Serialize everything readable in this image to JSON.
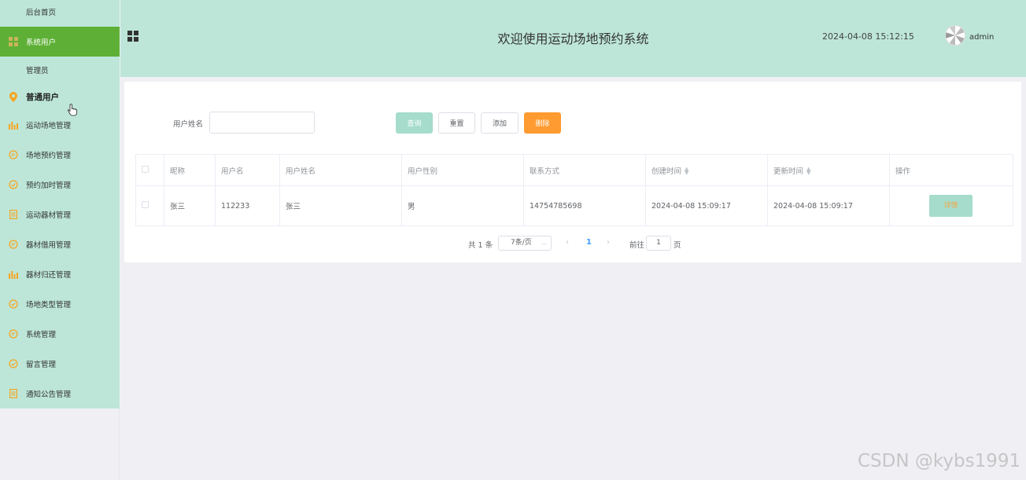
{
  "sidebar": {
    "items": [
      {
        "label": "后台首页",
        "icon": "none",
        "type": "sub"
      },
      {
        "label": "系统用户",
        "icon": "grid-icon",
        "type": "active"
      },
      {
        "label": "管理员",
        "icon": "none",
        "type": "sub"
      },
      {
        "label": "普通用户",
        "icon": "location-icon",
        "type": "bold"
      },
      {
        "label": "运动场地管理",
        "icon": "bar-chart-icon",
        "type": "normal"
      },
      {
        "label": "场地预约管理",
        "icon": "chat-icon",
        "type": "normal"
      },
      {
        "label": "预约加时管理",
        "icon": "check-circle-icon",
        "type": "normal"
      },
      {
        "label": "运动器材管理",
        "icon": "document-icon",
        "type": "normal"
      },
      {
        "label": "器材借用管理",
        "icon": "chat-icon",
        "type": "normal"
      },
      {
        "label": "器材归还管理",
        "icon": "bar-chart-icon",
        "type": "normal"
      },
      {
        "label": "场地类型管理",
        "icon": "check-circle-icon",
        "type": "normal"
      },
      {
        "label": "系统管理",
        "icon": "chat-icon",
        "type": "normal"
      },
      {
        "label": "留言管理",
        "icon": "check-circle-icon",
        "type": "normal"
      },
      {
        "label": "通知公告管理",
        "icon": "document-icon",
        "type": "normal"
      }
    ]
  },
  "header": {
    "title": "欢迎使用运动场地预约系统",
    "datetime": "2024-04-08 15:12:15",
    "username": "admin"
  },
  "search": {
    "label": "用户姓名",
    "value": "",
    "placeholder": ""
  },
  "buttons": {
    "query": "查询",
    "reset": "重置",
    "add": "添加",
    "delete": "删除"
  },
  "table": {
    "columns": [
      "昵称",
      "用户名",
      "用户姓名",
      "用户性别",
      "联系方式",
      "创建时间",
      "更新时间",
      "操作"
    ],
    "rows": [
      {
        "nickname": "张三",
        "username": "112233",
        "realname": "张三",
        "gender": "男",
        "contact": "14754785698",
        "created": "2024-04-08 15:09:17",
        "updated": "2024-04-08 15:09:17",
        "action": "详情"
      }
    ]
  },
  "pager": {
    "total": "共 1 条",
    "page_size": "7条/页",
    "current": "1",
    "goto_label": "前往",
    "goto_value": "1",
    "page_suffix": "页"
  },
  "watermark": "CSDN @kybs1991",
  "colors": {
    "theme_bg": "#bde6d8",
    "active_menu": "#5db035",
    "query_button": "#a6dccb",
    "delete_button": "#ff9b30",
    "icon_orange": "#f5a623"
  }
}
